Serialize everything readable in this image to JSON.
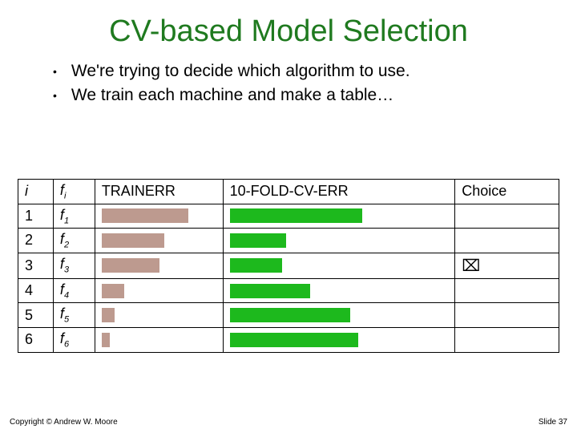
{
  "title": "CV-based Model Selection",
  "bullets": [
    "We're trying to decide which algorithm to use.",
    "We train each machine and make a table…"
  ],
  "headers": {
    "i": "i",
    "f": "f",
    "fsub": "i",
    "train": "TRAINERR",
    "cv": "10-FOLD-CV-ERR",
    "choice": "Choice"
  },
  "chart_data": {
    "type": "table",
    "title": "CV-based Model Selection",
    "xlabel": "i",
    "ylabel": "",
    "columns": [
      "i",
      "f_i",
      "TRAINERR",
      "10-FOLD-CV-ERR",
      "Choice"
    ],
    "trainerr_color": "#bd9a8f",
    "cv_color": "#1db91d",
    "trainerr_max_width": 150,
    "cv_max_width": 280,
    "series": [
      {
        "name": "TRAINERR",
        "values": [
          108,
          78,
          72,
          28,
          16,
          10
        ]
      },
      {
        "name": "10-FOLD-CV-ERR",
        "values": [
          165,
          70,
          65,
          100,
          150,
          160
        ]
      }
    ],
    "rows": [
      {
        "i": "1",
        "f": "f",
        "fsub": "1",
        "train_w": 108,
        "cv_w": 165,
        "choice": ""
      },
      {
        "i": "2",
        "f": "f",
        "fsub": "2",
        "train_w": 78,
        "cv_w": 70,
        "choice": ""
      },
      {
        "i": "3",
        "f": "f",
        "fsub": "3",
        "train_w": 72,
        "cv_w": 65,
        "choice": "⌧"
      },
      {
        "i": "4",
        "f": "f",
        "fsub": "4",
        "train_w": 28,
        "cv_w": 100,
        "choice": ""
      },
      {
        "i": "5",
        "f": "f",
        "fsub": "5",
        "train_w": 16,
        "cv_w": 150,
        "choice": ""
      },
      {
        "i": "6",
        "f": "f",
        "fsub": "6",
        "train_w": 10,
        "cv_w": 160,
        "choice": ""
      }
    ]
  },
  "footer": {
    "left": "Copyright © Andrew W. Moore",
    "right": "Slide 37"
  }
}
